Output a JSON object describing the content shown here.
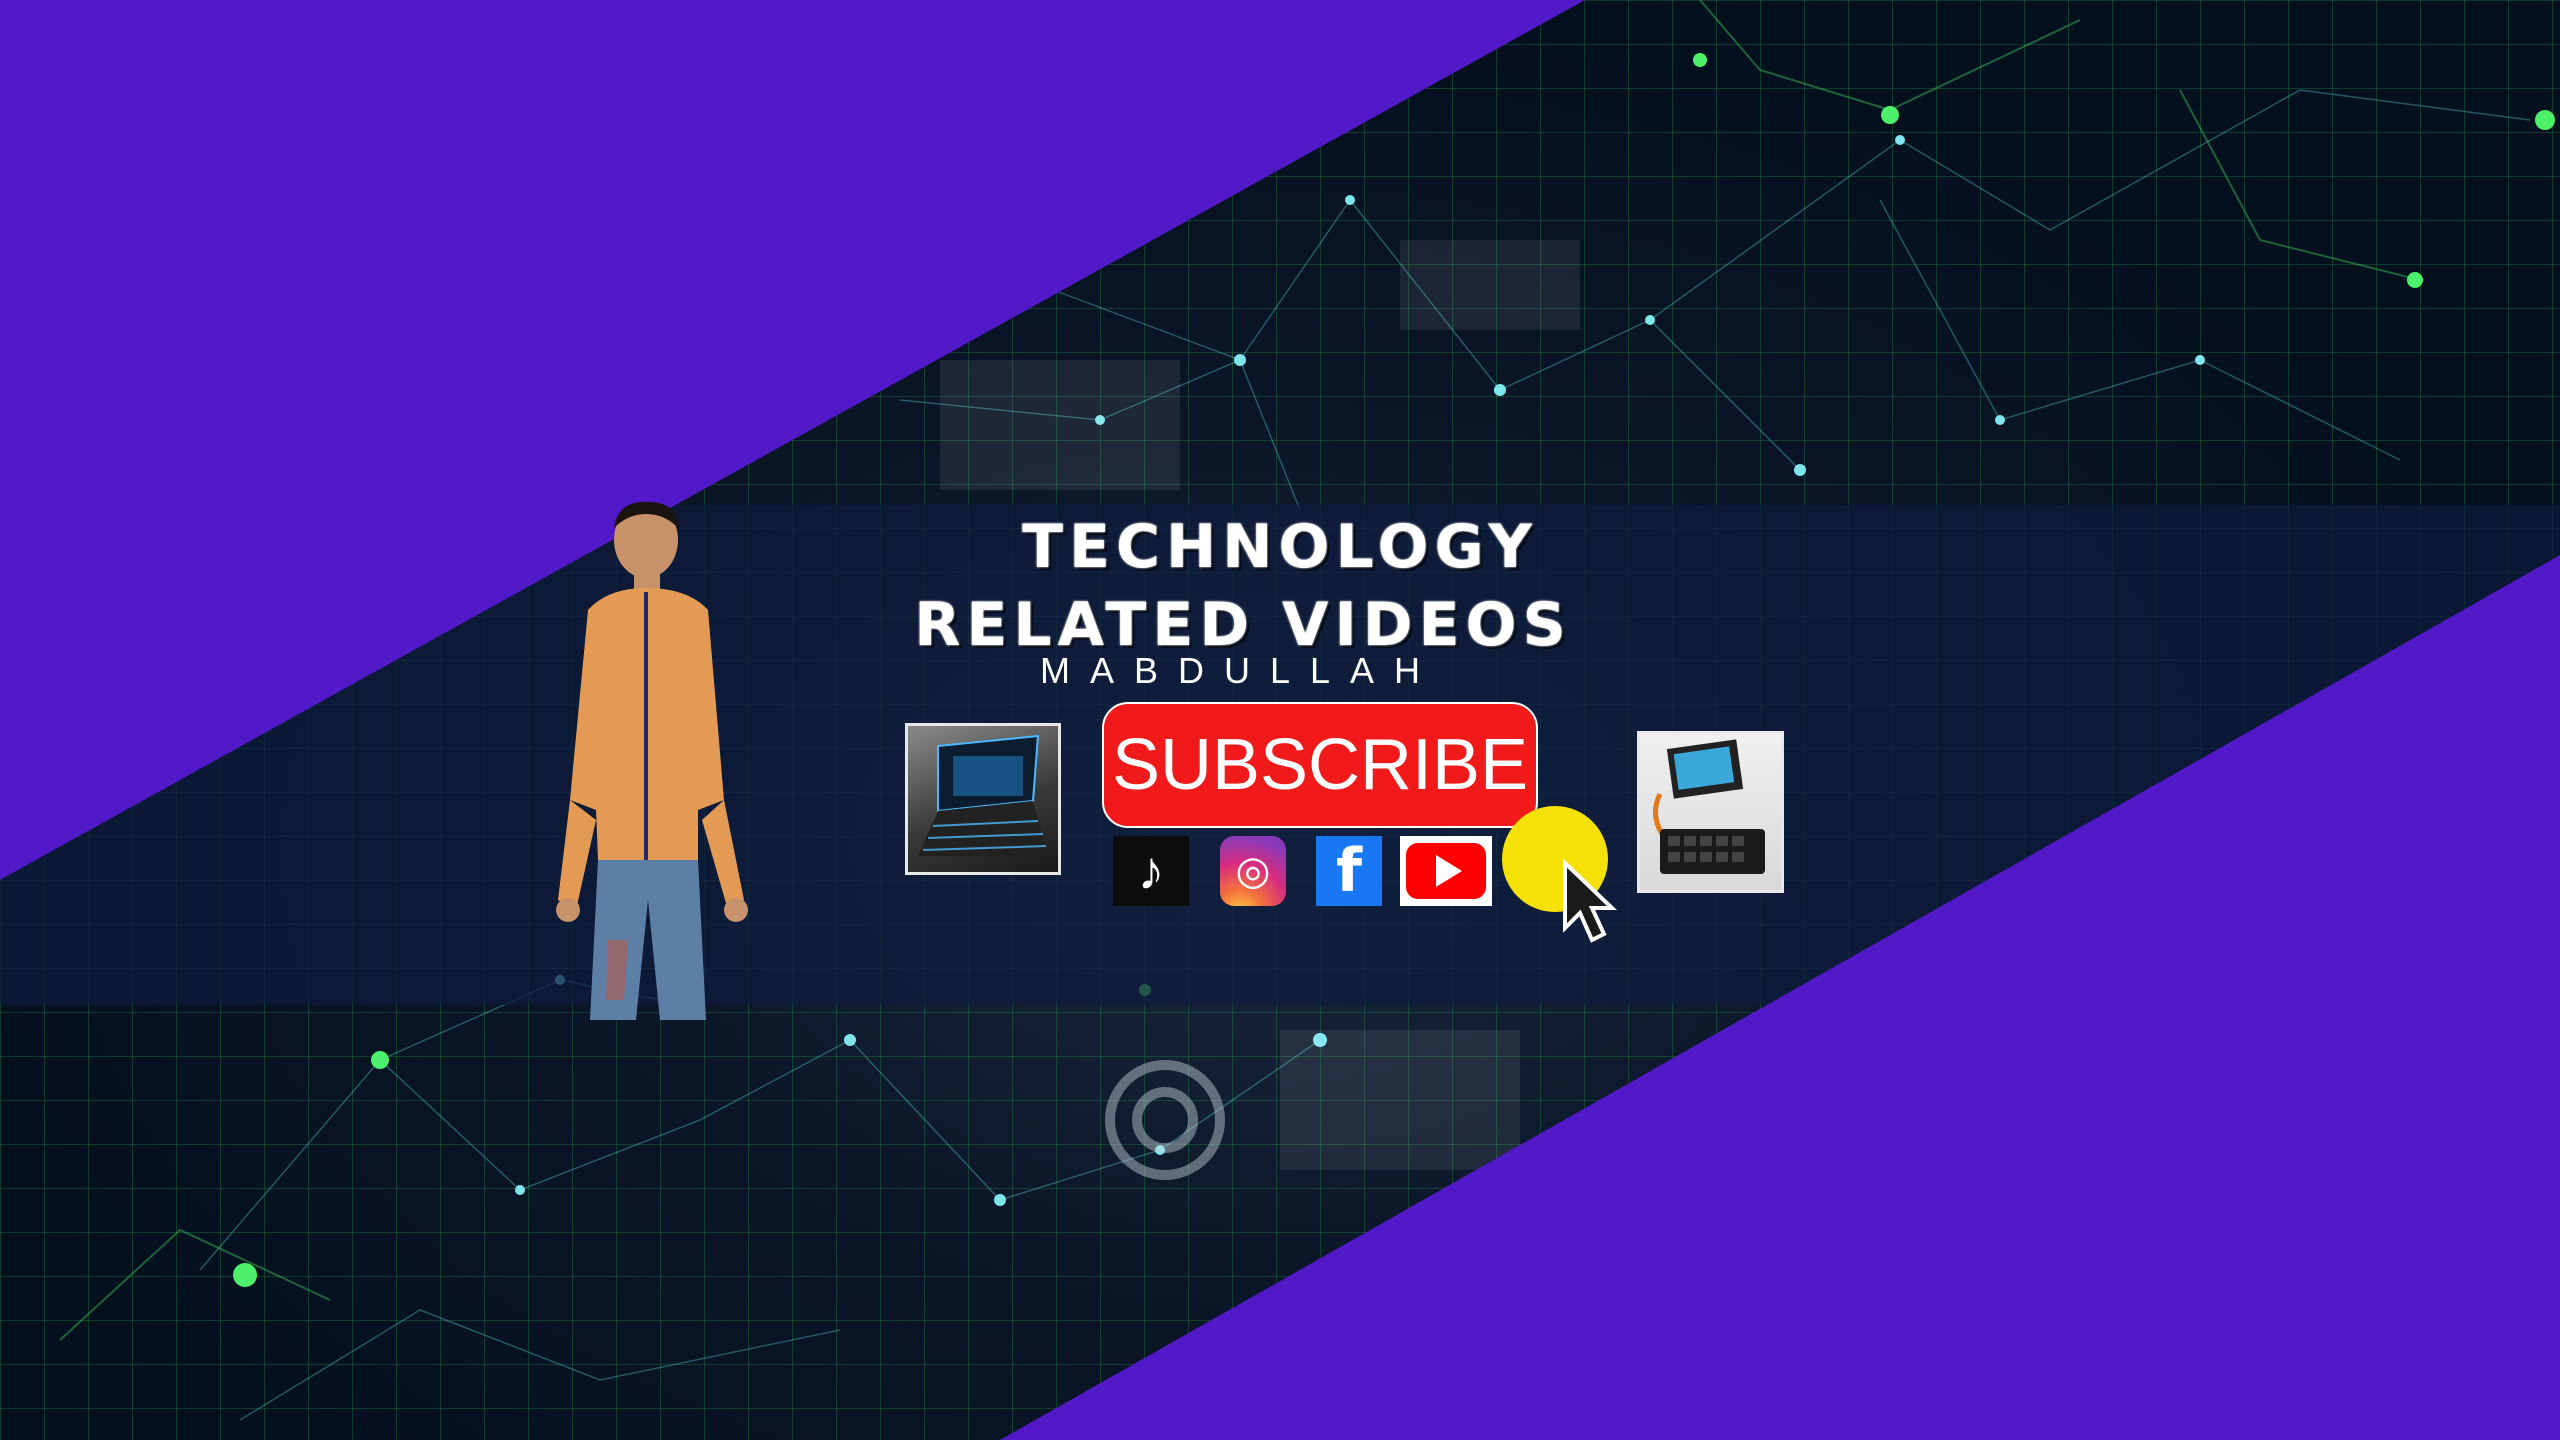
{
  "banner": {
    "title_line1": "TECHNOLOGY",
    "title_line2": "RELATED VIDEOS",
    "channel_name": "MABDULLAH",
    "subscribe_label": "SUBSCRIBE"
  },
  "socials": [
    {
      "name": "tiktok-icon",
      "glyph": "♪"
    },
    {
      "name": "instagram-icon",
      "glyph": "◎"
    },
    {
      "name": "facebook-icon",
      "glyph": "f"
    },
    {
      "name": "youtube-icon",
      "glyph": "▶"
    }
  ],
  "colors": {
    "background_purple": "#5219c8",
    "subscribe_red": "#f11a1a",
    "click_yellow": "#f5e008"
  }
}
